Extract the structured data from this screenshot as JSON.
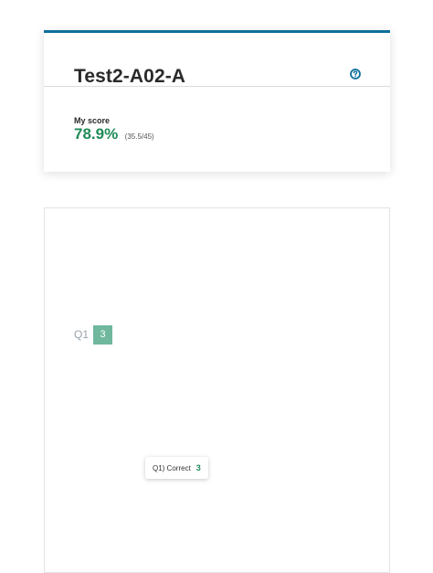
{
  "header": {
    "title": "Test2-A02-A",
    "help_icon": "help-circle-icon"
  },
  "score": {
    "label": "My score",
    "percent": "78.9%",
    "fraction": "(35.5/45)"
  },
  "questions": [
    {
      "label": "Q1",
      "score": "3",
      "tooltip_text": "Q1) Correct",
      "tooltip_score": "3"
    }
  ],
  "colors": {
    "accent_bar": "#0e6f9b",
    "score_green": "#1f8a57",
    "chip_green": "#6fb89d",
    "help_icon": "#0e6f9b"
  }
}
